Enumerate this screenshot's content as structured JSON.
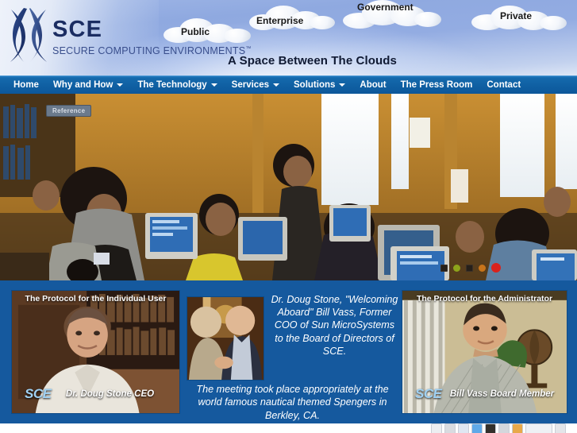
{
  "brand": {
    "name": "SCE",
    "full_name": "SECURE COMPUTING ENVIRONMENTS",
    "trademark": "™",
    "logo_icon": "sce-bowtie-logo-icon"
  },
  "header": {
    "tagline": "A Space Between The Clouds",
    "clouds": [
      {
        "label": "Public"
      },
      {
        "label": "Enterprise"
      },
      {
        "label": "Government"
      },
      {
        "label": "Private"
      }
    ]
  },
  "nav": {
    "items": [
      {
        "label": "Home",
        "has_dropdown": false
      },
      {
        "label": "Why and How",
        "has_dropdown": true
      },
      {
        "label": "The Technology",
        "has_dropdown": true
      },
      {
        "label": "Services",
        "has_dropdown": true
      },
      {
        "label": "Solutions",
        "has_dropdown": true
      },
      {
        "label": "About",
        "has_dropdown": false
      },
      {
        "label": "The Press Room",
        "has_dropdown": false
      },
      {
        "label": "Contact",
        "has_dropdown": false
      }
    ]
  },
  "hero": {
    "sign_text": "Reference",
    "dots": [
      {
        "color": "#8ea31b",
        "shape": "circle"
      },
      {
        "color": "#c8741a",
        "shape": "circle"
      },
      {
        "color": "#d9221c",
        "shape": "circle"
      }
    ]
  },
  "videos": {
    "left": {
      "title": "The Protocol for the Individual User",
      "logo": "SCE",
      "name": "Dr. Doug Stone CEO"
    },
    "right": {
      "title": "The Protocol for the Administrator",
      "logo": "SCE",
      "name": "Bill Vass   Board Member"
    }
  },
  "announcement": {
    "photo_caption": "handshake-photo",
    "lines_top": "Dr. Doug Stone, \"Welcoming Aboard\" Bill Vass, Former COO of Sun MicroSystems to the Board of Directors of SCE.",
    "lines_bottom": "The meeting took place appropriately at the world famous nautical themed Spengers in Berkley, CA."
  },
  "colors": {
    "nav_blue": "#0f5fa2",
    "panel_blue": "#15599e",
    "logo_navy": "#1b2d62",
    "sky_blue": "#93ace2"
  }
}
